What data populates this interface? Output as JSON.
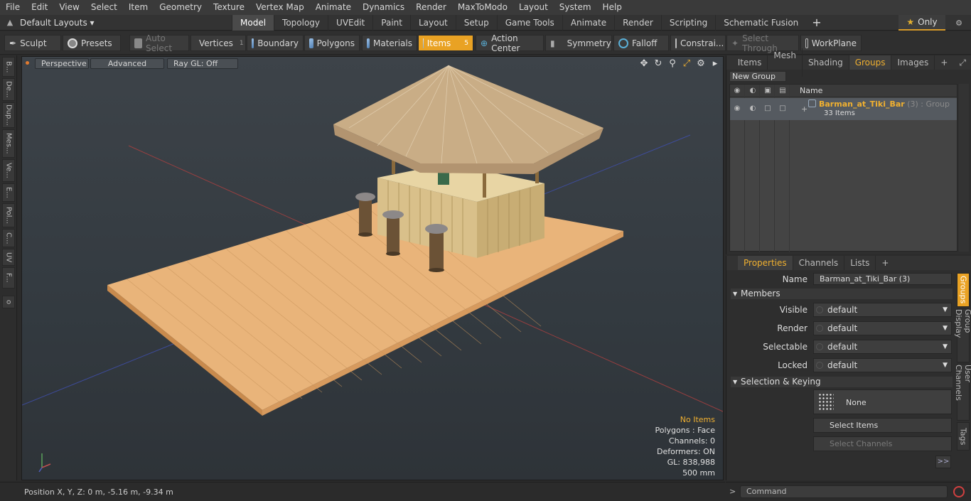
{
  "menu": [
    "File",
    "Edit",
    "View",
    "Select",
    "Item",
    "Geometry",
    "Texture",
    "Vertex Map",
    "Animate",
    "Dynamics",
    "Render",
    "MaxToModo",
    "Layout",
    "System",
    "Help"
  ],
  "layout": {
    "selector": "Default Layouts ▾",
    "tabs": [
      "Model",
      "Topology",
      "UVEdit",
      "Paint",
      "Layout",
      "Setup",
      "Game Tools",
      "Animate",
      "Render",
      "Scripting",
      "Schematic Fusion"
    ],
    "active_tab": "Model",
    "only_label": "Only"
  },
  "toolbar": {
    "sculpt": "Sculpt",
    "presets": "Presets",
    "auto_select": "Auto Select",
    "vertices": "Vertices",
    "vertices_count": "1",
    "boundary": "Boundary",
    "polygons": "Polygons",
    "materials": "Materials",
    "items": "Items",
    "items_count": "5",
    "action_center": "Action Center",
    "symmetry": "Symmetry",
    "falloff": "Falloff",
    "constraints": "Constrai...",
    "select_through": "Select Through",
    "workplane": "WorkPlane"
  },
  "left_tabs": [
    "B...",
    "De...",
    "Dup...",
    "Mes...",
    "Ve...",
    "E...",
    "Pol...",
    "C...",
    "UV",
    "F..."
  ],
  "viewport": {
    "view": "Perspective",
    "shading": "Advanced",
    "raygl": "Ray GL: Off",
    "stats": {
      "items": "No Items",
      "polygons": "Polygons : Face",
      "channels": "Channels: 0",
      "deformers": "Deformers: ON",
      "gl": "GL: 838,988",
      "scale": "500 mm"
    }
  },
  "status": {
    "position": "Position X, Y, Z:   0 m, -5.16 m, -9.34 m"
  },
  "groups_panel": {
    "tabs": [
      "Items",
      "Mesh ...",
      "Shading",
      "Groups",
      "Images"
    ],
    "active_tab": "Groups",
    "new_group": "New Group",
    "col_name": "Name",
    "group_name": "Barman_at_Tiki_Bar",
    "group_suffix": " (3) : Group",
    "group_items": "33 Items"
  },
  "properties": {
    "tabs": [
      "Properties",
      "Channels",
      "Lists"
    ],
    "active_tab": "Properties",
    "name_label": "Name",
    "name_value": "Barman_at_Tiki_Bar (3)",
    "members_section": "Members",
    "visible_label": "Visible",
    "visible_value": "default",
    "render_label": "Render",
    "render_value": "default",
    "selectable_label": "Selectable",
    "selectable_value": "default",
    "locked_label": "Locked",
    "locked_value": "default",
    "selkey_section": "Selection & Keying",
    "none_label": "None",
    "select_items": "Select Items",
    "select_channels": "Select Channels",
    "side_tabs": [
      "Groups",
      "Group Display",
      "User Channels",
      "Tags"
    ],
    "expand": ">>"
  },
  "command": {
    "placeholder": "Command"
  }
}
